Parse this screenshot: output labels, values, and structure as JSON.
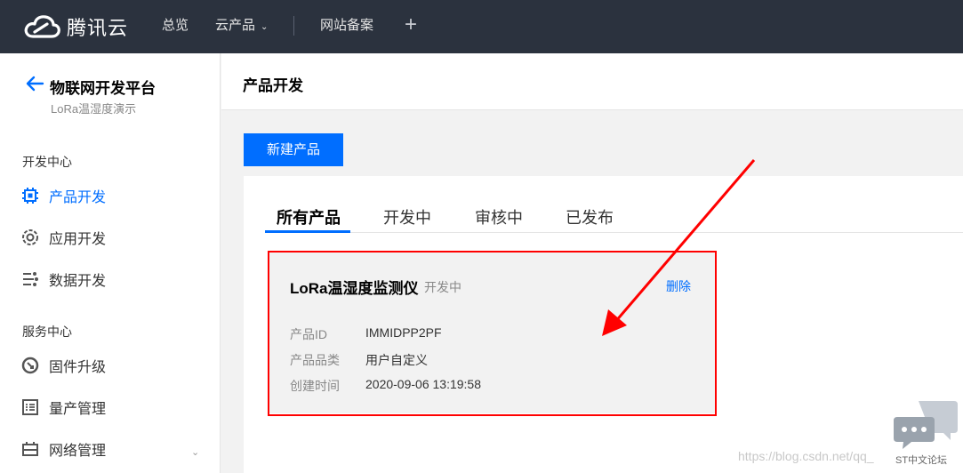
{
  "topbar": {
    "brand": "腾讯云",
    "nav": [
      "总览",
      "云产品",
      "网站备案"
    ]
  },
  "sidebar": {
    "title": "物联网开发平台",
    "subtitle": "LoRa温湿度演示",
    "sections": [
      {
        "label": "开发中心",
        "items": [
          "产品开发",
          "应用开发",
          "数据开发"
        ]
      },
      {
        "label": "服务中心",
        "items": [
          "固件升级",
          "量产管理",
          "网络管理"
        ]
      }
    ]
  },
  "main": {
    "title": "产品开发",
    "new_button": "新建产品",
    "tabs": [
      "所有产品",
      "开发中",
      "审核中",
      "已发布"
    ],
    "product": {
      "name": "LoRa温湿度监测仪",
      "status": "开发中",
      "delete": "删除",
      "fields": [
        {
          "label": "产品ID",
          "value": "IMMIDPP2PF"
        },
        {
          "label": "产品品类",
          "value": "用户自定义"
        },
        {
          "label": "创建时间",
          "value": "2020-09-06 13:19:58"
        }
      ]
    }
  },
  "watermark": {
    "url": "https://blog.csdn.net/qq_",
    "forum": "ST中文论坛"
  },
  "colors": {
    "accent": "#006eff",
    "topbar": "#2b323e",
    "annotation": "#ff0000"
  }
}
